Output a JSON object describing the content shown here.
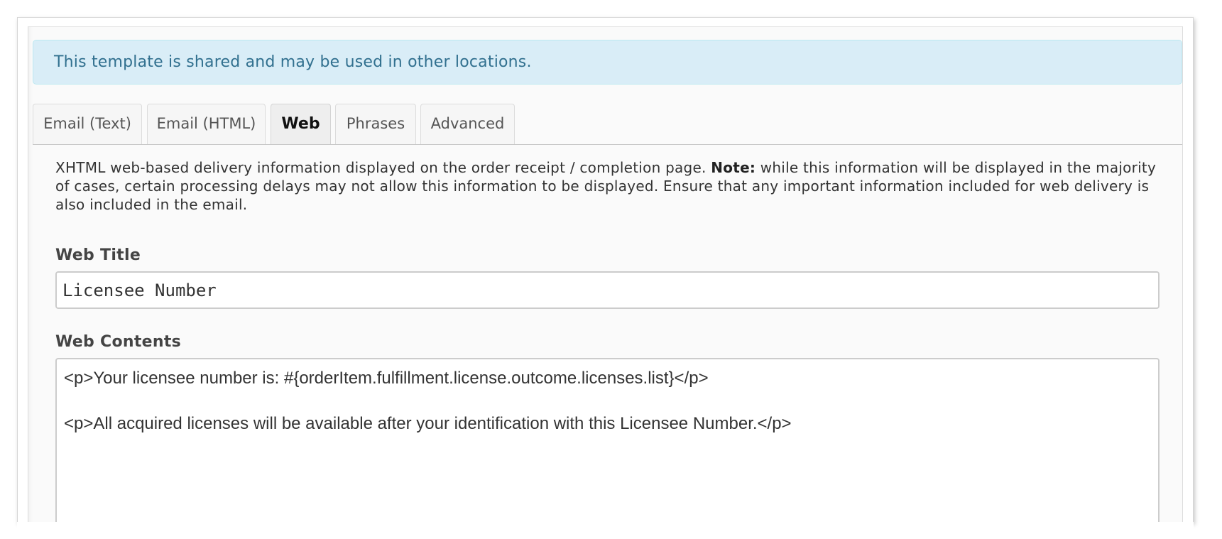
{
  "alert": {
    "message": "This template is shared and may be used in other locations."
  },
  "tabs": [
    {
      "label": "Email (Text)",
      "active": false
    },
    {
      "label": "Email (HTML)",
      "active": false
    },
    {
      "label": "Web",
      "active": true
    },
    {
      "label": "Phrases",
      "active": false
    },
    {
      "label": "Advanced",
      "active": false
    }
  ],
  "web": {
    "description_start": "XHTML web-based delivery information displayed on the order receipt / completion page. ",
    "description_note_label": "Note:",
    "description_rest": " while this information will be displayed in the majority of cases, certain processing delays may not allow this information to be displayed. Ensure that any important information included for web delivery is also included in the email.",
    "title_label": "Web Title",
    "title_value": "Licensee Number",
    "contents_label": "Web Contents",
    "contents_value": "<p>Your licensee number is: #{orderItem.fulfillment.license.outcome.licenses.list}</p>\n\n<p>All acquired licenses will be available after your identification with this Licensee Number.</p>"
  },
  "colors": {
    "alert_bg": "#d9edf7",
    "alert_text": "#31708f",
    "alert_border": "#bce8f1"
  }
}
